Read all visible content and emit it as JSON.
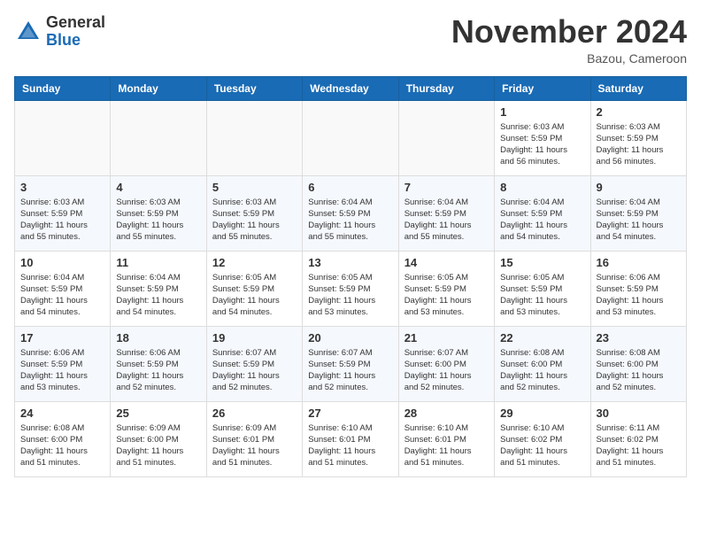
{
  "header": {
    "logo": {
      "general": "General",
      "blue": "Blue"
    },
    "title": "November 2024",
    "location": "Bazou, Cameroon"
  },
  "weekdays": [
    "Sunday",
    "Monday",
    "Tuesday",
    "Wednesday",
    "Thursday",
    "Friday",
    "Saturday"
  ],
  "weeks": [
    [
      {
        "day": "",
        "info": ""
      },
      {
        "day": "",
        "info": ""
      },
      {
        "day": "",
        "info": ""
      },
      {
        "day": "",
        "info": ""
      },
      {
        "day": "",
        "info": ""
      },
      {
        "day": "1",
        "info": "Sunrise: 6:03 AM\nSunset: 5:59 PM\nDaylight: 11 hours\nand 56 minutes."
      },
      {
        "day": "2",
        "info": "Sunrise: 6:03 AM\nSunset: 5:59 PM\nDaylight: 11 hours\nand 56 minutes."
      }
    ],
    [
      {
        "day": "3",
        "info": "Sunrise: 6:03 AM\nSunset: 5:59 PM\nDaylight: 11 hours\nand 55 minutes."
      },
      {
        "day": "4",
        "info": "Sunrise: 6:03 AM\nSunset: 5:59 PM\nDaylight: 11 hours\nand 55 minutes."
      },
      {
        "day": "5",
        "info": "Sunrise: 6:03 AM\nSunset: 5:59 PM\nDaylight: 11 hours\nand 55 minutes."
      },
      {
        "day": "6",
        "info": "Sunrise: 6:04 AM\nSunset: 5:59 PM\nDaylight: 11 hours\nand 55 minutes."
      },
      {
        "day": "7",
        "info": "Sunrise: 6:04 AM\nSunset: 5:59 PM\nDaylight: 11 hours\nand 55 minutes."
      },
      {
        "day": "8",
        "info": "Sunrise: 6:04 AM\nSunset: 5:59 PM\nDaylight: 11 hours\nand 54 minutes."
      },
      {
        "day": "9",
        "info": "Sunrise: 6:04 AM\nSunset: 5:59 PM\nDaylight: 11 hours\nand 54 minutes."
      }
    ],
    [
      {
        "day": "10",
        "info": "Sunrise: 6:04 AM\nSunset: 5:59 PM\nDaylight: 11 hours\nand 54 minutes."
      },
      {
        "day": "11",
        "info": "Sunrise: 6:04 AM\nSunset: 5:59 PM\nDaylight: 11 hours\nand 54 minutes."
      },
      {
        "day": "12",
        "info": "Sunrise: 6:05 AM\nSunset: 5:59 PM\nDaylight: 11 hours\nand 54 minutes."
      },
      {
        "day": "13",
        "info": "Sunrise: 6:05 AM\nSunset: 5:59 PM\nDaylight: 11 hours\nand 53 minutes."
      },
      {
        "day": "14",
        "info": "Sunrise: 6:05 AM\nSunset: 5:59 PM\nDaylight: 11 hours\nand 53 minutes."
      },
      {
        "day": "15",
        "info": "Sunrise: 6:05 AM\nSunset: 5:59 PM\nDaylight: 11 hours\nand 53 minutes."
      },
      {
        "day": "16",
        "info": "Sunrise: 6:06 AM\nSunset: 5:59 PM\nDaylight: 11 hours\nand 53 minutes."
      }
    ],
    [
      {
        "day": "17",
        "info": "Sunrise: 6:06 AM\nSunset: 5:59 PM\nDaylight: 11 hours\nand 53 minutes."
      },
      {
        "day": "18",
        "info": "Sunrise: 6:06 AM\nSunset: 5:59 PM\nDaylight: 11 hours\nand 52 minutes."
      },
      {
        "day": "19",
        "info": "Sunrise: 6:07 AM\nSunset: 5:59 PM\nDaylight: 11 hours\nand 52 minutes."
      },
      {
        "day": "20",
        "info": "Sunrise: 6:07 AM\nSunset: 5:59 PM\nDaylight: 11 hours\nand 52 minutes."
      },
      {
        "day": "21",
        "info": "Sunrise: 6:07 AM\nSunset: 6:00 PM\nDaylight: 11 hours\nand 52 minutes."
      },
      {
        "day": "22",
        "info": "Sunrise: 6:08 AM\nSunset: 6:00 PM\nDaylight: 11 hours\nand 52 minutes."
      },
      {
        "day": "23",
        "info": "Sunrise: 6:08 AM\nSunset: 6:00 PM\nDaylight: 11 hours\nand 52 minutes."
      }
    ],
    [
      {
        "day": "24",
        "info": "Sunrise: 6:08 AM\nSunset: 6:00 PM\nDaylight: 11 hours\nand 51 minutes."
      },
      {
        "day": "25",
        "info": "Sunrise: 6:09 AM\nSunset: 6:00 PM\nDaylight: 11 hours\nand 51 minutes."
      },
      {
        "day": "26",
        "info": "Sunrise: 6:09 AM\nSunset: 6:01 PM\nDaylight: 11 hours\nand 51 minutes."
      },
      {
        "day": "27",
        "info": "Sunrise: 6:10 AM\nSunset: 6:01 PM\nDaylight: 11 hours\nand 51 minutes."
      },
      {
        "day": "28",
        "info": "Sunrise: 6:10 AM\nSunset: 6:01 PM\nDaylight: 11 hours\nand 51 minutes."
      },
      {
        "day": "29",
        "info": "Sunrise: 6:10 AM\nSunset: 6:02 PM\nDaylight: 11 hours\nand 51 minutes."
      },
      {
        "day": "30",
        "info": "Sunrise: 6:11 AM\nSunset: 6:02 PM\nDaylight: 11 hours\nand 51 minutes."
      }
    ]
  ]
}
